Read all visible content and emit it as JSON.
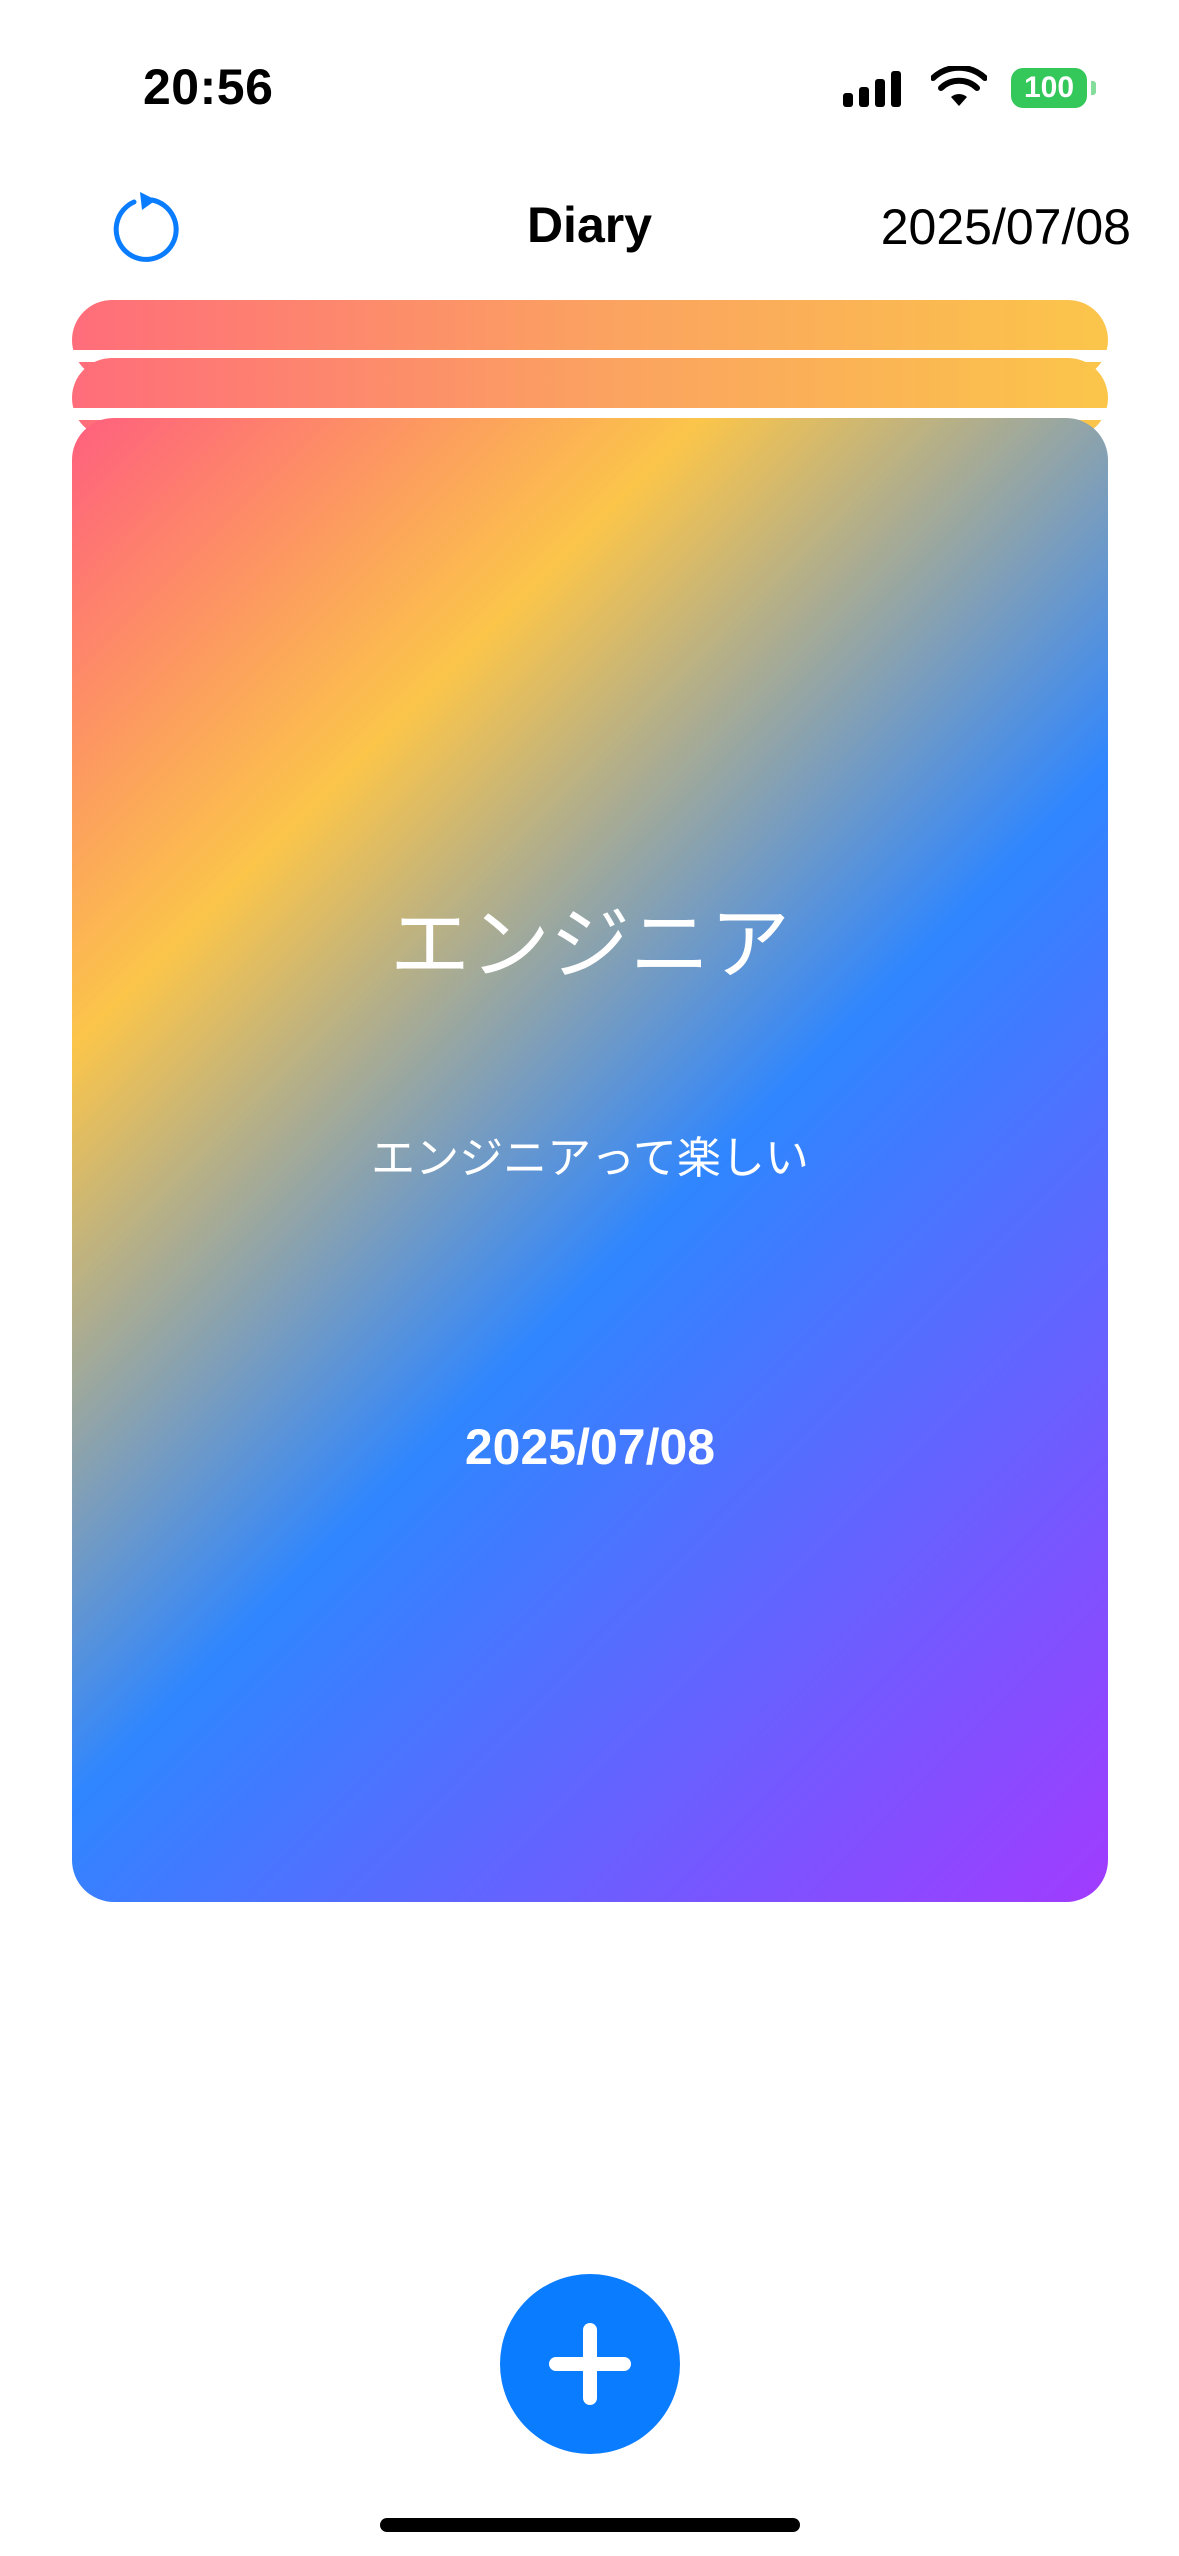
{
  "status_bar": {
    "time": "20:56",
    "battery": "100"
  },
  "nav": {
    "title": "Diary",
    "date": "2025/07/08",
    "refresh_icon": "refresh-icon"
  },
  "card": {
    "title": "エンジニア",
    "body": "エンジニアって楽しい",
    "date": "2025/07/08"
  },
  "fab": {
    "icon": "plus-icon"
  },
  "colors": {
    "accent": "#0a7cff",
    "battery": "#34c759",
    "gradient": [
      "#ff5f7e",
      "#fbc54a",
      "#2f86ff",
      "#a13bff"
    ]
  }
}
